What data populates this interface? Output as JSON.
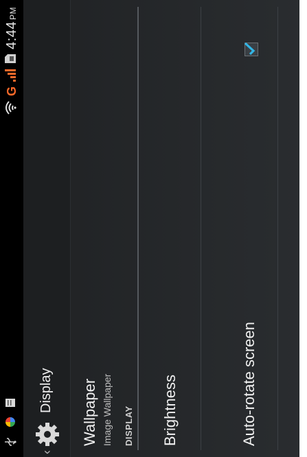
{
  "status_bar": {
    "time": "4:44",
    "ampm": "PM",
    "network_label": "G",
    "icons": [
      "usb-icon",
      "photos-icon",
      "notification-icon",
      "wifi-icon",
      "signal-icon",
      "sim-icon"
    ],
    "signal_color": "#ff6a2a"
  },
  "action_bar": {
    "title": "Display",
    "icon": "settings-gear-icon"
  },
  "wallpaper": {
    "title": "Wallpaper",
    "summary": "Image Wallpaper"
  },
  "section_header": "DISPLAY",
  "brightness": {
    "title": "Brightness"
  },
  "auto_rotate": {
    "title": "Auto-rotate screen",
    "checked": true
  },
  "colors": {
    "accent": "#33b5e5",
    "background": "#25282b"
  }
}
